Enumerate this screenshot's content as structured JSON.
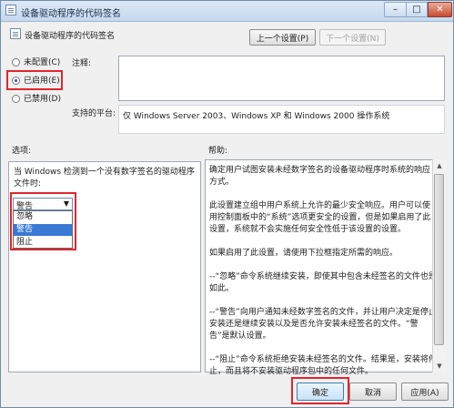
{
  "window": {
    "title": "设备驱动程序的代码签名",
    "min": "–",
    "max": "□",
    "close": "✕"
  },
  "header": {
    "title": "设备驱动程序的代码签名"
  },
  "nav": {
    "prev": "上一个设置(P)",
    "next": "下一个设置(N)"
  },
  "state": {
    "options": [
      {
        "label": "未配置(C)",
        "selected": false
      },
      {
        "label": "已启用(E)",
        "selected": true
      },
      {
        "label": "已禁用(D)",
        "selected": false
      }
    ]
  },
  "comment": {
    "label": "注释:",
    "value": ""
  },
  "platform": {
    "label": "支持的平台:",
    "value": "仅 Windows Server 2003、Windows XP 和 Windows 2000 操作系统"
  },
  "options_section": {
    "label": "选项:",
    "desc": "当 Windows 检测到一个没有数字签名的驱动程序文件时:",
    "selected": "警告",
    "list": [
      "忽略",
      "警告",
      "阻止"
    ]
  },
  "help_section": {
    "label": "帮助:",
    "paragraphs": [
      "确定用户试图安装未经数字签名的设备驱动程序时系统的响应方式。",
      "此设置建立组中用户系统上允许的最少安全响应。用户可以使用控制面板中的“系统”选项更安全的设置，但是如果启用了此设置，系统就不会实施任何安全性低于该设置的设置。",
      "如果启用了此设置，请使用下拉框指定所需的响应。",
      "--“忽略”命令系统继续安装，即使其中包含未经签名的文件也是如此。",
      "--“警告”向用户通知未经数字签名的文件，并让用户决定是停止安装还是继续安装以及是否允许安装未经签名的文件。“警告”是默认设置。",
      "--“阻止”命令系统拒绝安装未经签名的文件。结果是，安装将停止，而且将不安装驱动程序包中的任何文件。"
    ]
  },
  "footer": {
    "ok": "确定",
    "cancel": "取消",
    "apply": "应用(A)"
  }
}
